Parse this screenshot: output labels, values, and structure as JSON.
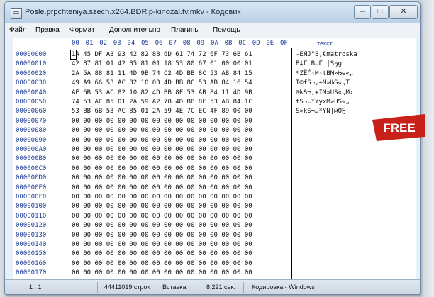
{
  "window": {
    "title": "Posle.prpchteniya.szech.x264.BDRip-kinozal.tv.mkv - Кодовик",
    "buttons": {
      "minimize": "–",
      "maximize": "□",
      "close": "✕"
    }
  },
  "menu": [
    "Файл",
    "Правка",
    "Формат",
    "Дополнительно",
    "Плагины",
    "Помощь"
  ],
  "hex_header": [
    "00",
    "01",
    "02",
    "03",
    "04",
    "05",
    "06",
    "07",
    "08",
    "09",
    "0A",
    "0B",
    "0C",
    "0D",
    "0E",
    "0F"
  ],
  "text_column_title": "текст",
  "rows": [
    {
      "addr": "00000000",
      "hex": "1A 45 DF A3 93 42 82 88 6D 61 74 72 6F 73 6B 61",
      "text": "-ЕЯЈ\"В‚€matroska"
    },
    {
      "addr": "00000010",
      "hex": "42 87 81 01 42 85 81 01 18 53 80 67 01 00 00 01",
      "text": "B‡Ѓ B…Ѓ |Sђg"
    },
    {
      "addr": "00000020",
      "hex": "2A 5A 88 81 11 4D 9B 74 C2 4D BB 8C 53 AB 84 15",
      "text": "*ZЁЃ›M›tВМ»Ње«„"
    },
    {
      "addr": "00000030",
      "hex": "49 A9 66 53 AC 82 10 03 4D BB 8C 53 AB 84 16 54",
      "text": "I©fS¬‚+М»ЊS«„Т"
    },
    {
      "addr": "00000040",
      "hex": "AE 6B 53 AC 82 10 82 4D BB 8F 53 AB 84 11 4D 9B",
      "text": "®kS¬‚+IМ»US«„М›"
    },
    {
      "addr": "00000050",
      "hex": "74 53 AC 85 01 2A 59 A2 78 4D BB 8F 53 AB 84 1C",
      "text": "tS¬…*YўхМ»US«„"
    },
    {
      "addr": "00000060",
      "hex": "53 BB 6B 53 AC 85 01 2A 59 4E 7C EC 4F 89 00 00",
      "text": "S»kS¬…*YN|мOЂ"
    },
    {
      "addr": "00000070",
      "hex": "00 00 00 00 00 00 00 00 00 00 00 00 00 00 00 00",
      "text": ""
    },
    {
      "addr": "00000080",
      "hex": "00 00 00 00 00 00 00 00 00 00 00 00 00 00 00 00",
      "text": ""
    },
    {
      "addr": "00000090",
      "hex": "00 00 00 00 00 00 00 00 00 00 00 00 00 00 00 00",
      "text": ""
    },
    {
      "addr": "000000A0",
      "hex": "00 00 00 00 00 00 00 00 00 00 00 00 00 00 00 00",
      "text": ""
    },
    {
      "addr": "000000B0",
      "hex": "00 00 00 00 00 00 00 00 00 00 00 00 00 00 00 00",
      "text": ""
    },
    {
      "addr": "000000C0",
      "hex": "00 00 00 00 00 00 00 00 00 00 00 00 00 00 00 00",
      "text": ""
    },
    {
      "addr": "000000D0",
      "hex": "00 00 00 00 00 00 00 00 00 00 00 00 00 00 00 00",
      "text": ""
    },
    {
      "addr": "000000E0",
      "hex": "00 00 00 00 00 00 00 00 00 00 00 00 00 00 00 00",
      "text": ""
    },
    {
      "addr": "000000F0",
      "hex": "00 00 00 00 00 00 00 00 00 00 00 00 00 00 00 00",
      "text": ""
    },
    {
      "addr": "00000100",
      "hex": "00 00 00 00 00 00 00 00 00 00 00 00 00 00 00 00",
      "text": ""
    },
    {
      "addr": "00000110",
      "hex": "00 00 00 00 00 00 00 00 00 00 00 00 00 00 00 00",
      "text": ""
    },
    {
      "addr": "00000120",
      "hex": "00 00 00 00 00 00 00 00 00 00 00 00 00 00 00 00",
      "text": ""
    },
    {
      "addr": "00000130",
      "hex": "00 00 00 00 00 00 00 00 00 00 00 00 00 00 00 00",
      "text": ""
    },
    {
      "addr": "00000140",
      "hex": "00 00 00 00 00 00 00 00 00 00 00 00 00 00 00 00",
      "text": ""
    },
    {
      "addr": "00000150",
      "hex": "00 00 00 00 00 00 00 00 00 00 00 00 00 00 00 00",
      "text": ""
    },
    {
      "addr": "00000160",
      "hex": "00 00 00 00 00 00 00 00 00 00 00 00 00 00 00 00",
      "text": ""
    },
    {
      "addr": "00000170",
      "hex": "00 00 00 00 00 00 00 00 00 00 00 00 00 00 00 00",
      "text": ""
    }
  ],
  "badge": {
    "text": "FREE",
    "color": "#d0241c"
  },
  "status": {
    "position": "1 : 1",
    "rows": "44411019 строк",
    "mode": "Вставка",
    "time": "8.221 сек.",
    "encoding": "Кодировка - Windows"
  }
}
